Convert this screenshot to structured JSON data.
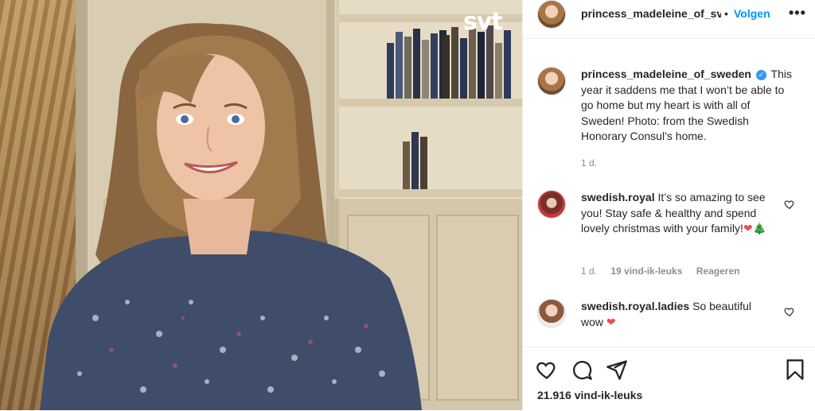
{
  "post": {
    "photo_watermark": "svt",
    "author": "princess_madeleine_of_sweden",
    "author_truncated": "princess_madeleine_of_sv",
    "separator": "•",
    "follow_label": "Volgen",
    "more_label": "•••",
    "caption": "This year it saddens me that I won’t be able to go home but my heart is with all of Sweden! Photo: from the Swedish Honorary Consul’s home.",
    "caption_time": "1 d.",
    "verified_icon": "✓"
  },
  "comments": [
    {
      "user": "swedish.royal",
      "text": "It’s so amazing to see you! Stay safe & healthy and spend lovely christmas with your family!",
      "emoji": "❤🎄",
      "time": "1 d.",
      "likes": "19 vind-ik-leuks",
      "reply": "Reageren"
    },
    {
      "user": "swedish.royal.ladies",
      "text": "So beautiful wow",
      "emoji": "❤",
      "time": "",
      "likes": "",
      "reply": ""
    }
  ],
  "actions": {
    "icons": [
      "heart-icon",
      "comment-icon",
      "share-icon",
      "bookmark-icon"
    ],
    "likes_count": "21.916 vind-ik-leuks"
  },
  "colors": {
    "link_blue": "#0095f6",
    "verified_blue": "#3897f0",
    "text": "#262626",
    "muted": "#8e8e8e",
    "heart_red": "#ed4956"
  }
}
